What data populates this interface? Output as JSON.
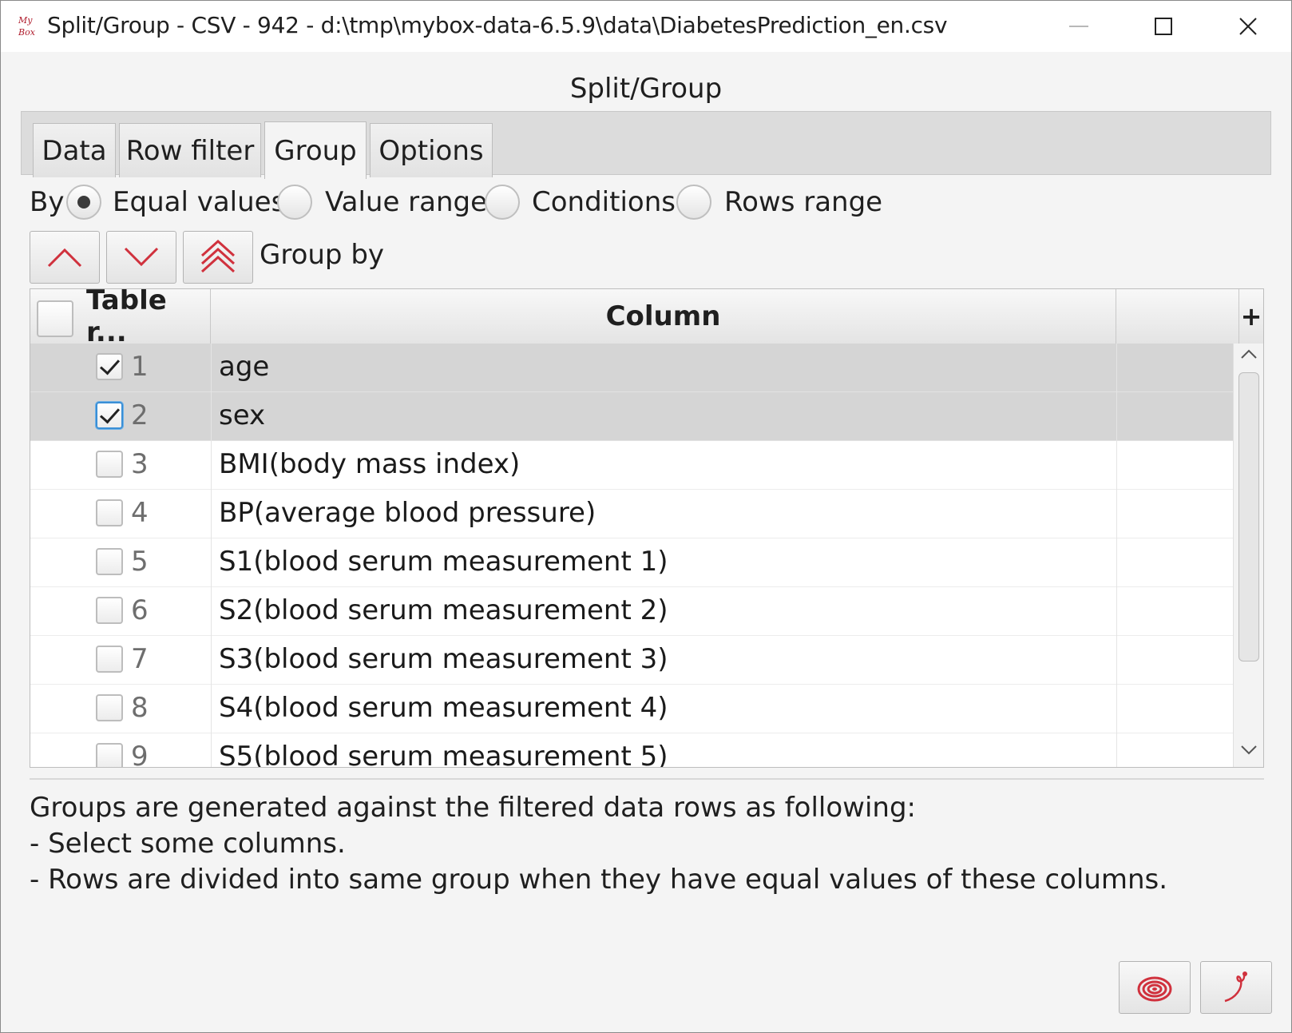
{
  "window": {
    "title": "Split/Group - CSV - 942 - d:\\tmp\\mybox-data-6.5.9\\data\\DiabetesPrediction_en.csv",
    "app_icon_lines": [
      "My",
      "Box"
    ]
  },
  "dialog": {
    "title": "Split/Group"
  },
  "tabs": [
    {
      "label": "Data",
      "active": false
    },
    {
      "label": "Row filter",
      "active": false
    },
    {
      "label": "Group",
      "active": true
    },
    {
      "label": "Options",
      "active": false
    }
  ],
  "by": {
    "label": "By",
    "options": [
      {
        "label": "Equal values",
        "checked": true
      },
      {
        "label": "Value range",
        "checked": false
      },
      {
        "label": "Conditions",
        "checked": false
      },
      {
        "label": "Rows range",
        "checked": false
      }
    ]
  },
  "group_by": {
    "label": "Group by",
    "buttons": [
      "move-up-icon",
      "move-down-icon",
      "move-top-icon"
    ]
  },
  "table": {
    "headers": {
      "row": "Table r...",
      "column": "Column",
      "extra": "",
      "add": "+"
    },
    "rows": [
      {
        "num": "1",
        "name": "age",
        "checked": true,
        "selected": true
      },
      {
        "num": "2",
        "name": "sex",
        "checked": true,
        "selected": true
      },
      {
        "num": "3",
        "name": "BMI(body mass index)",
        "checked": false,
        "selected": false
      },
      {
        "num": "4",
        "name": "BP(average blood pressure)",
        "checked": false,
        "selected": false
      },
      {
        "num": "5",
        "name": "S1(blood serum measurement 1)",
        "checked": false,
        "selected": false
      },
      {
        "num": "6",
        "name": "S2(blood serum measurement 2)",
        "checked": false,
        "selected": false
      },
      {
        "num": "7",
        "name": "S3(blood serum measurement 3)",
        "checked": false,
        "selected": false
      },
      {
        "num": "8",
        "name": "S4(blood serum measurement 4)",
        "checked": false,
        "selected": false
      },
      {
        "num": "9",
        "name": "S5(blood serum measurement 5)",
        "checked": false,
        "selected": false
      }
    ]
  },
  "info": {
    "lines": [
      "Groups are generated against the filtered data rows as following:",
      "- Select some columns.",
      "- Rows are divided into same group when they have equal values of these columns."
    ]
  },
  "footer": {
    "buttons": [
      "spiral-icon",
      "clear-icon"
    ]
  },
  "colors": {
    "accent_red": "#d0313d",
    "selected_row": "#d5d5d5",
    "focus_blue": "#3a8fd6"
  }
}
